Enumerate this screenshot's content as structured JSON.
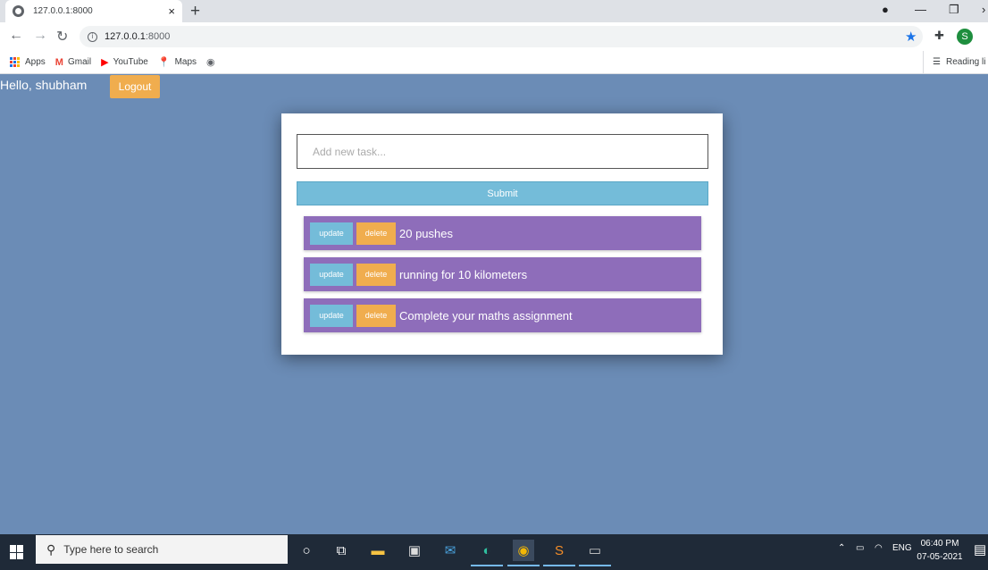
{
  "browser": {
    "tab_title": "127.0.0.1:8000",
    "tab_close": "×",
    "new_tab": "+",
    "url_host": "127.0.0.1",
    "url_port": ":8000",
    "profile_initial": "S",
    "bookmarks": [
      {
        "label": "Apps",
        "icon": "apps-grid-icon"
      },
      {
        "label": "Gmail",
        "icon": "gmail-icon"
      },
      {
        "label": "YouTube",
        "icon": "youtube-icon"
      },
      {
        "label": "Maps",
        "icon": "maps-icon"
      }
    ],
    "reading_list": "Reading li",
    "accent": "#1a73e8"
  },
  "page": {
    "greeting": "Hello, shubham",
    "logout_label": "Logout",
    "input_placeholder": "Add new task...",
    "submit_label": "Submit",
    "update_label": "update",
    "delete_label": "delete",
    "tasks": [
      {
        "text": "20 pushes"
      },
      {
        "text": "running for 10 kilometers"
      },
      {
        "text": "Complete your maths assignment"
      }
    ],
    "colors": {
      "background": "#6b8cb6",
      "task": "#8e6dba",
      "update": "#74bcd9",
      "delete": "#f0ad4e"
    }
  },
  "taskbar": {
    "search_placeholder": "Type here to search",
    "language": "ENG",
    "time": "06:40 PM",
    "date": "07-05-2021"
  }
}
